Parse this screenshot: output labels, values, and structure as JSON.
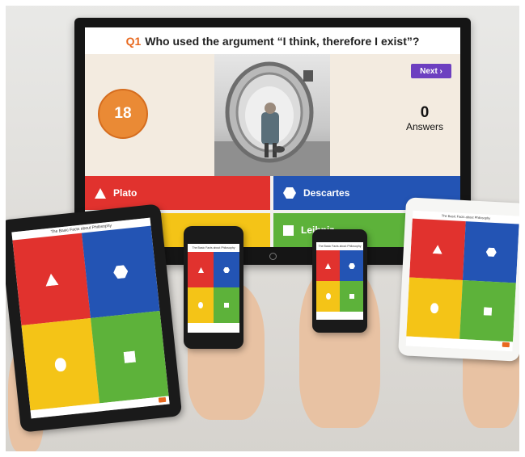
{
  "tv": {
    "question_number": "Q1",
    "question_text": "Who used the argument “I think, therefore I exist”?",
    "timer_value": "18",
    "next_label": "Next ›",
    "answers_count": "0",
    "answers_label": "Answers",
    "options": [
      {
        "label": "Plato",
        "shape": "triangle-icon",
        "color": "#e1322e"
      },
      {
        "label": "Descartes",
        "shape": "hexagon-icon",
        "color": "#2354b4"
      },
      {
        "label": "",
        "shape": "circle-icon",
        "color": "#f4c417"
      },
      {
        "label": "Leibniz",
        "shape": "square-icon",
        "color": "#5db23a"
      }
    ]
  },
  "device_screen_title": "The Basic Facts about Philosophy",
  "colors": {
    "red": "#e1322e",
    "blue": "#2354b4",
    "yellow": "#f4c417",
    "green": "#5db23a",
    "accent": "#e8691f",
    "purple": "#6d3fc0"
  }
}
